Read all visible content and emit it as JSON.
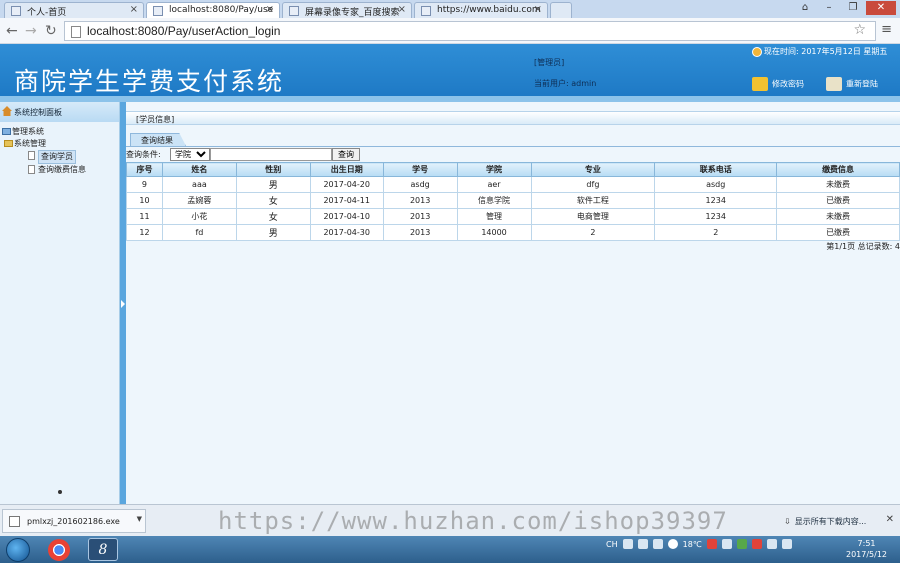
{
  "browser": {
    "tabs": [
      {
        "label": "个人-首页"
      },
      {
        "label": "localhost:8080/Pay/use"
      },
      {
        "label": "屏幕录像专家_百度搜索"
      },
      {
        "label": "https://www.baidu.com"
      }
    ],
    "url": "localhost:8080/Pay/userAction_login"
  },
  "header": {
    "title": "商院学生学费支付系统",
    "role": "[管理员]",
    "current_user": "当前用户: admin",
    "datetime": "现在时间: 2017年5月12日 星期五",
    "change_password": "修改密码",
    "relogin": "重新登陆"
  },
  "sidebar": {
    "head": "系统控制面板",
    "root": "管理系统",
    "group": "系统管理",
    "items": [
      {
        "label": "查询学员"
      },
      {
        "label": "查询缴费信息"
      }
    ]
  },
  "main": {
    "breadcrumb": "[学员信息]",
    "result_tab": "查询结果",
    "filter_label": "查询条件:",
    "filter_selected": "学院",
    "query_button": "查询",
    "columns": [
      "序号",
      "姓名",
      "性别",
      "出生日期",
      "学号",
      "学院",
      "专业",
      "联系电话",
      "缴费信息"
    ],
    "rows": [
      [
        "9",
        "aaa",
        "男",
        "2017-04-20",
        "asdg",
        "aer",
        "dfg",
        "asdg",
        "未缴费"
      ],
      [
        "10",
        "孟婉蓉",
        "女",
        "2017-04-11",
        "2013",
        "信息学院",
        "软件工程",
        "1234",
        "已缴费"
      ],
      [
        "11",
        "小花",
        "女",
        "2017-04-10",
        "2013",
        "管理",
        "电商管理",
        "1234",
        "未缴费"
      ],
      [
        "12",
        "fd",
        "男",
        "2017-04-30",
        "2013",
        "14000",
        "2",
        "2",
        "已缴费"
      ]
    ],
    "pager": "第1/1页  总记录数: 4"
  },
  "downloads": {
    "file": "pmlxzj_201602186.exe",
    "watermark": "https://www.huzhan.com/ishop39397",
    "show_all": "显示所有下载内容..."
  },
  "taskbar": {
    "ime": "CH",
    "temperature": "18℃",
    "time": "7:51",
    "date": "2017/5/12"
  }
}
